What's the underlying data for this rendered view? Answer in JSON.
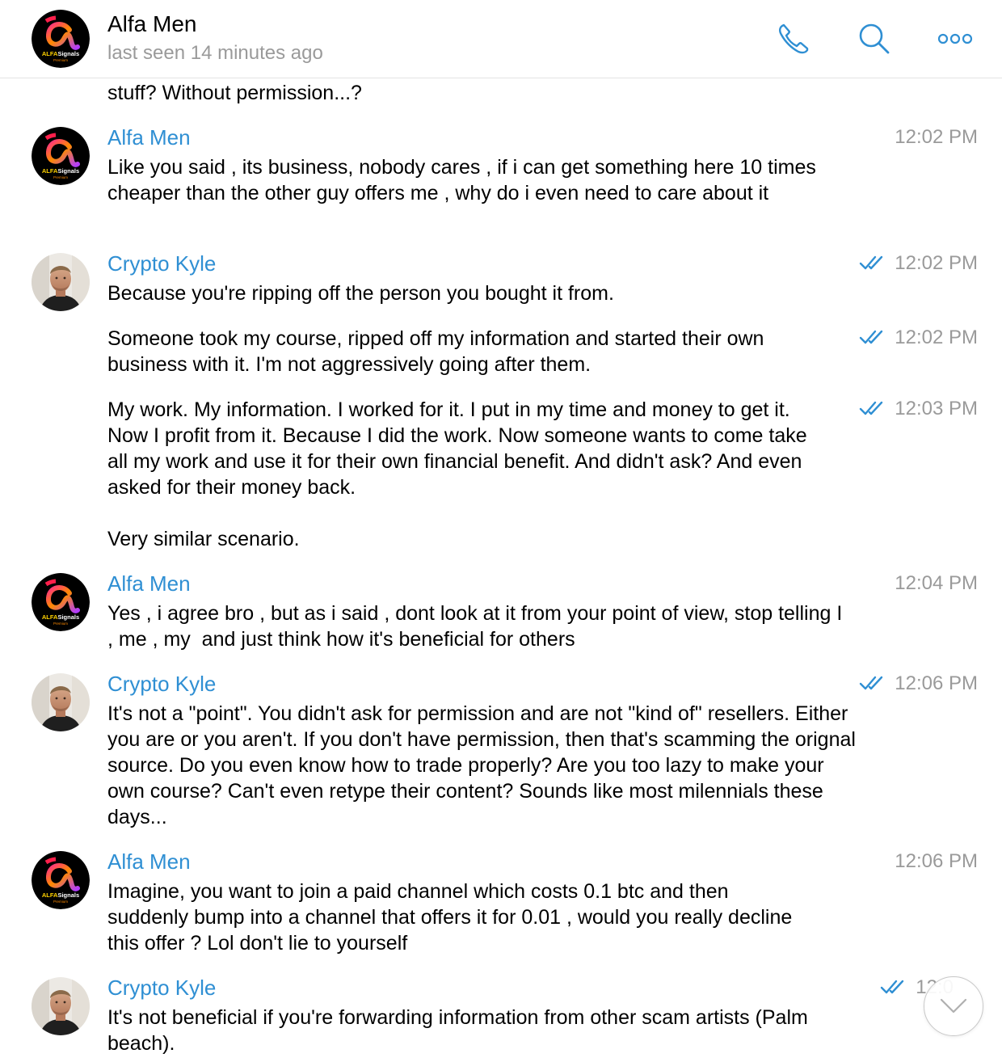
{
  "header": {
    "title": "Alfa Men",
    "status": "last seen 14 minutes ago",
    "avatar_text": "ALFASignals",
    "avatar_subtext": "Premium"
  },
  "colors": {
    "accent": "#2f8fd3",
    "timestamp": "#9a9a9a",
    "check": "#2f8fd3"
  },
  "icons": [
    "phone-icon",
    "search-icon",
    "more-icon",
    "double-check-icon",
    "chevron-down-icon"
  ],
  "messages": [
    {
      "sender": "",
      "time": "",
      "read": false,
      "text": "stuff? Without permission...?"
    },
    {
      "sender": "Alfa Men",
      "time": "12:02 PM",
      "read": false,
      "text": "Like you said , its business, nobody cares , if i can get something here 10 times cheaper than the other guy offers me , why do i even need to care about it"
    },
    {
      "sender": "Crypto Kyle",
      "time": "12:02 PM",
      "read": true,
      "text": "Because you're ripping off the person you bought it from."
    },
    {
      "sender": "",
      "time": "12:02 PM",
      "read": true,
      "text": "Someone took my course, ripped off my information and started their own business with it. I'm not aggressively going after them."
    },
    {
      "sender": "",
      "time": "12:03 PM",
      "read": true,
      "text": "My work. My information. I worked for it. I put in my time and money to get it. Now I profit from it. Because I did the work. Now someone wants to come take all my work and use it for their own financial benefit. And didn't ask? And even asked for their money back.\n\nVery similar scenario."
    },
    {
      "sender": "Alfa Men",
      "time": "12:04 PM",
      "read": false,
      "text": "Yes , i agree bro , but as i said , dont look at it from your point of view, stop telling I , me , my  and just think how it's beneficial for others"
    },
    {
      "sender": "Crypto Kyle",
      "time": "12:06 PM",
      "read": true,
      "text": "It's not a \"point\". You didn't ask for permission and are not \"kind of\" resellers. Either you are or you aren't. If you don't have permission, then that's scamming the orignal source. Do you even know how to trade properly? Are you too lazy to make your own course? Can't even retype their content? Sounds like most milennials these days..."
    },
    {
      "sender": "Alfa Men",
      "time": "12:06 PM",
      "read": false,
      "text": "Imagine, you want to join a paid channel which costs 0.1 btc and then suddenly bump into a channel that offers it for 0.01 , would you really decline this offer ? Lol don't lie to yourself"
    },
    {
      "sender": "Crypto Kyle",
      "time": "12:0",
      "read": true,
      "text": "It's not beneficial if you're forwarding information from other scam artists (Palm beach)."
    }
  ]
}
